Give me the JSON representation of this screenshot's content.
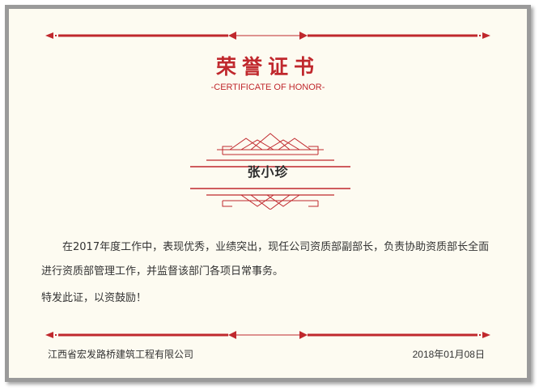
{
  "certificate": {
    "title": "荣誉证书",
    "subtitle": "-CERTIFICATE OF HONOR-",
    "recipient": "张小珍",
    "body": "在2017年度工作中，表现优秀，业绩突出，现任公司资质部副部长，负责协助资质部长全面进行资质部管理工作，并监督该部门各项日常事务。",
    "closing": "特发此证，以资鼓励！",
    "organization": "江西省宏发路桥建筑工程有限公司",
    "date": "2018年01月08日"
  },
  "colors": {
    "accent": "#c0282d",
    "paper": "#fdfbf1",
    "frame": "#9a9a9a"
  }
}
